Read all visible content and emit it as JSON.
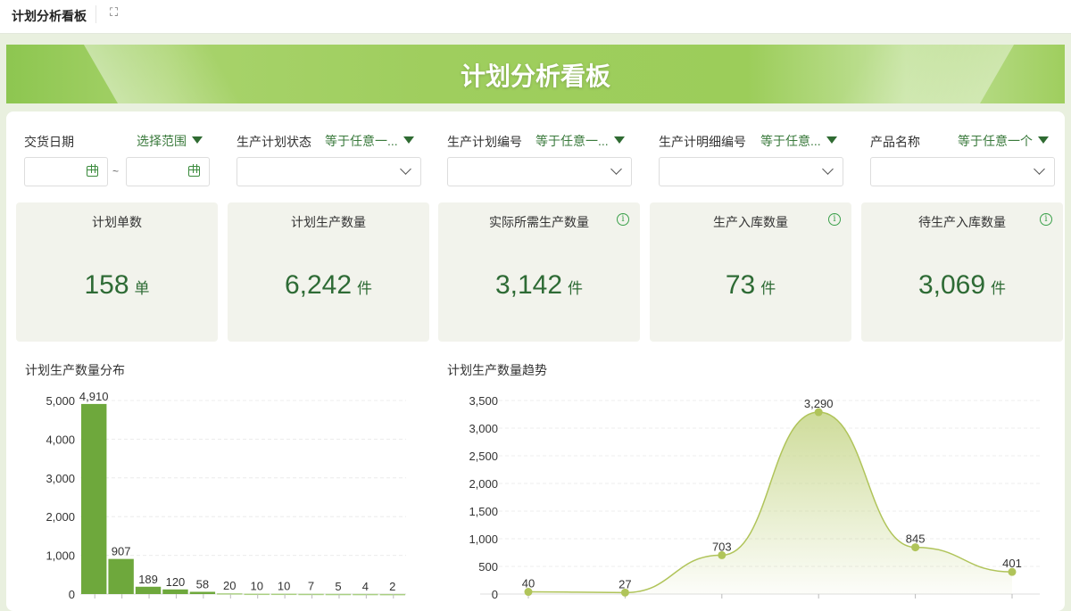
{
  "topbar": {
    "title": "计划分析看板",
    "fullscreen_icon": "expand-icon"
  },
  "banner": {
    "title": "计划分析看板"
  },
  "filters": [
    {
      "label": "交货日期",
      "operator": "选择范围",
      "type": "date-range",
      "start": "",
      "end": "",
      "separator": "~"
    },
    {
      "label": "生产计划状态",
      "operator": "等于任意一...",
      "value": ""
    },
    {
      "label": "生产计划编号",
      "operator": "等于任意一...",
      "value": ""
    },
    {
      "label": "生产计明细编号",
      "operator": "等于任意...",
      "value": ""
    },
    {
      "label": "产品名称",
      "operator": "等于任意一个",
      "value": ""
    }
  ],
  "kpis": [
    {
      "title": "计划单数",
      "value": "158",
      "unit": "单",
      "info": false
    },
    {
      "title": "计划生产数量",
      "value": "6,242",
      "unit": "件",
      "info": false
    },
    {
      "title": "实际所需生产数量",
      "value": "3,142",
      "unit": "件",
      "info": true
    },
    {
      "title": "生产入库数量",
      "value": "73",
      "unit": "件",
      "info": true
    },
    {
      "title": "待生产入库数量",
      "value": "3,069",
      "unit": "件",
      "info": true
    }
  ],
  "colors": {
    "accent": "#6ea83c",
    "line": "#b0c45a",
    "kpi_value": "#2e6b35"
  },
  "chart_data": [
    {
      "type": "bar",
      "title": "计划生产数量分布",
      "values": [
        4910,
        907,
        189,
        120,
        58,
        20,
        10,
        10,
        7,
        5,
        4,
        2
      ],
      "value_labels": [
        "4,910",
        "907",
        "189",
        "120",
        "58",
        "20",
        "10",
        "10",
        "7",
        "5",
        "4",
        "2"
      ],
      "yticks": [
        "0",
        "1,000",
        "2,000",
        "3,000",
        "4,000",
        "5,000"
      ],
      "ylim": [
        0,
        5000
      ],
      "grid": true
    },
    {
      "type": "area",
      "title": "计划生产数量趋势",
      "values": [
        40,
        27,
        703,
        3290,
        845,
        401
      ],
      "value_labels": [
        "40",
        "27",
        "703",
        "3,290",
        "845",
        "401"
      ],
      "yticks": [
        "0",
        "500",
        "1,000",
        "1,500",
        "2,000",
        "2,500",
        "3,000",
        "3,500"
      ],
      "ylim": [
        0,
        3500
      ],
      "grid": true
    }
  ]
}
